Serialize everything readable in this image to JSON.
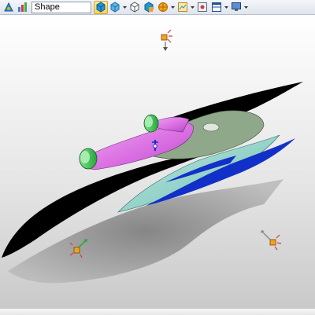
{
  "toolbar": {
    "shape_selector": {
      "value": "Shape"
    },
    "icons": [
      "display-style-icon",
      "select-filter-icon",
      "shaded-edges-icon",
      "cube-icon",
      "wireframe-cube-icon",
      "view-orientation-icon",
      "section-view-icon",
      "grid-icon",
      "window-split-icon",
      "monitor-icon"
    ]
  },
  "colors": {
    "accent_orange": "#f2a21d",
    "surface_magenta": "#d86be0",
    "surface_teal": "#7ec9c0",
    "surface_blue": "#1230c8",
    "roller_green": "#32c24a"
  }
}
